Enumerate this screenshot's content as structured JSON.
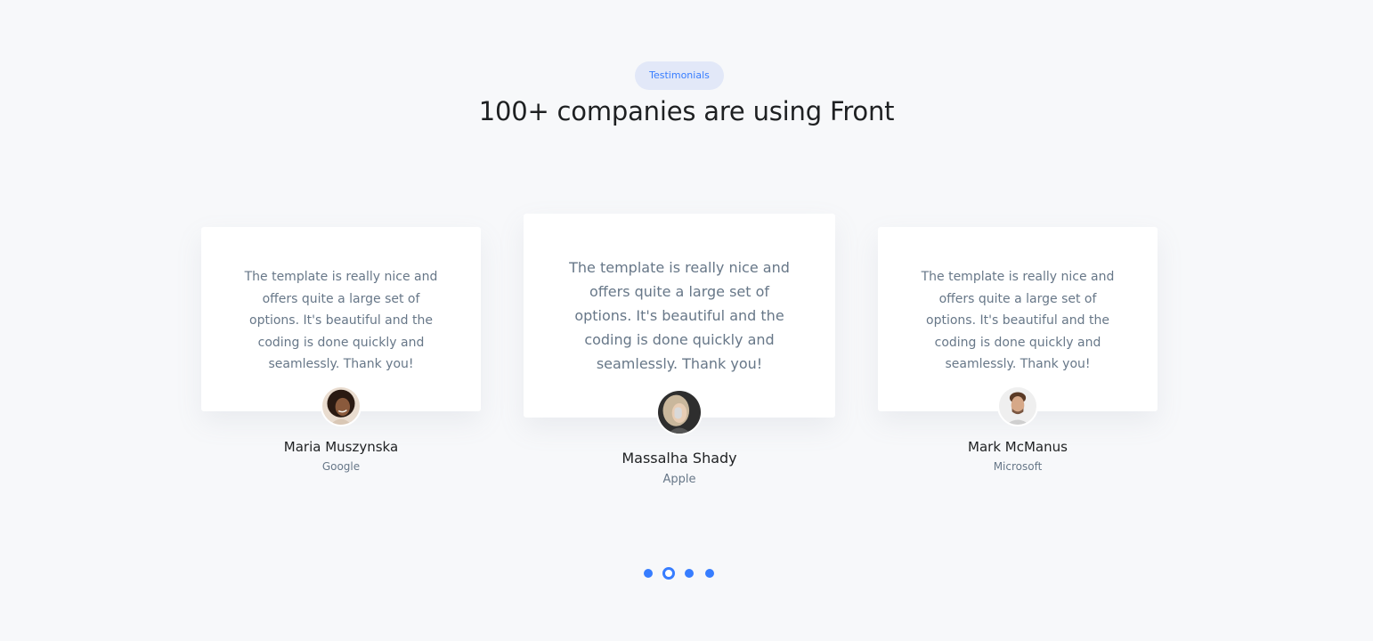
{
  "section": {
    "badge_label": "Testimonials",
    "title": "100+ companies are using Front"
  },
  "testimonials": [
    {
      "quote": "The template is really nice and offers quite a large set of options. It's beautiful and the coding is done quickly and seamlessly. Thank you!",
      "name": "Maria Muszynska",
      "company": "Google"
    },
    {
      "quote": "The template is really nice and offers quite a large set of options. It's beautiful and the coding is done quickly and seamlessly. Thank you!",
      "name": "Massalha Shady",
      "company": "Apple"
    },
    {
      "quote": "The template is really nice and offers quite a large set of options. It's beautiful and the coding is done quickly and seamlessly. Thank you!",
      "name": "Mark McManus",
      "company": "Microsoft"
    }
  ],
  "pagination": {
    "count": 4,
    "active_index": 1
  },
  "colors": {
    "accent": "#377dff",
    "badge_bg": "#e2e8f8",
    "background": "#f7f8fa",
    "text_muted": "#677788",
    "text_dark": "#1e2022"
  }
}
